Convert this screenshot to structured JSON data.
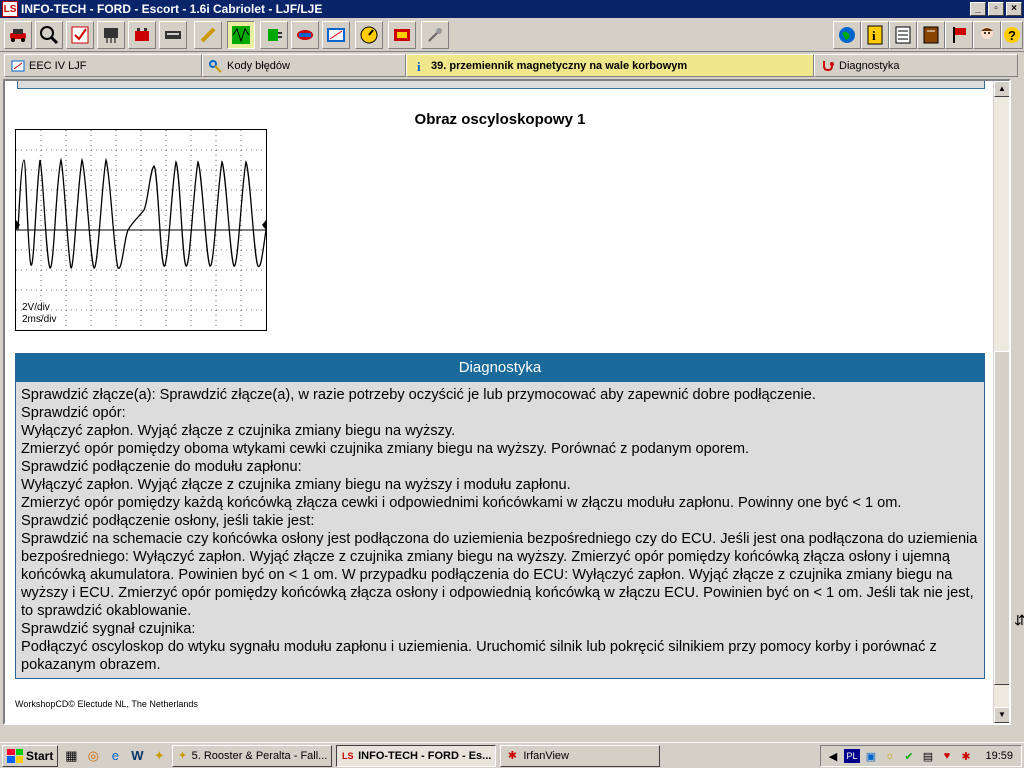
{
  "window": {
    "title": "INFO-TECH - FORD - Escort - 1.6i Cabriolet - LJF/LJE",
    "logo": "LS",
    "min_label": "_",
    "max_label": "▫",
    "close_label": "×"
  },
  "toolbar": {
    "left_icons": [
      "car-icon",
      "search-icon",
      "checklist-icon",
      "connector-icon",
      "battery-icon",
      "keyboard-icon",
      "pencil-icon",
      "oscilloscope-icon",
      "plug-icon",
      "component-icon",
      "module-icon",
      "dashboard-icon",
      "ecu-icon",
      "pin-icon"
    ],
    "right_icons": [
      "globe-icon",
      "info-icon",
      "list-icon",
      "book-icon",
      "flag-icon",
      "person-icon",
      "help-icon"
    ]
  },
  "tabs": [
    {
      "label": "EEC IV LJF",
      "icon": "module-icon"
    },
    {
      "label": "Kody błędów",
      "icon": "key-icon"
    },
    {
      "label": "39. przemiennik magnetyczny na wale korbowym",
      "icon": "info-icon"
    },
    {
      "label": "Diagnostyka",
      "icon": "stethoscope-icon"
    }
  ],
  "content": {
    "section_title": "Obraz oscyloskopowy 1",
    "scope_volt_label": "2V/div",
    "scope_time_label": "2ms/div",
    "diagnostics_title": "Diagnostyka",
    "diagnostics_lines": [
      "Sprawdzić złącze(a): Sprawdzić złącze(a), w razie potrzeby oczyścić je lub przymocować aby zapewnić dobre podłączenie.",
      "Sprawdzić opór:",
      "Wyłączyć zapłon. Wyjąć złącze z czujnika zmiany biegu na wyższy.",
      "Zmierzyć opór pomiędzy oboma wtykami cewki czujnika zmiany biegu na wyższy. Porównać z podanym oporem.",
      "Sprawdzić podłączenie do modułu zapłonu:",
      "Wyłączyć zapłon. Wyjąć złącze z czujnika zmiany biegu na wyższy i modułu zapłonu.",
      "Zmierzyć opór pomiędzy każdą końcówką złącza cewki i odpowiednimi końcówkami w złączu modułu zapłonu. Powinny one być < 1 om.",
      "Sprawdzić podłączenie osłony, jeśli takie jest:",
      "Sprawdzić na schemacie czy końcówka osłony jest podłączona do uziemienia bezpośredniego czy do ECU. Jeśli jest ona podłączona do uziemienia bezpośredniego: Wyłączyć zapłon. Wyjąć złącze z czujnika zmiany biegu na wyższy. Zmierzyć opór pomiędzy końcówką złącza osłony i ujemną końcówką akumulatora. Powinien być on < 1 om. W przypadku podłączenia do ECU: Wyłączyć zapłon. Wyjąć złącze z czujnika zmiany biegu na wyższy i ECU. Zmierzyć opór pomiędzy końcówką złącza osłony i odpowiednią końcówką w złączu ECU. Powinien być on < 1 om. Jeśli tak nie jest, to sprawdzić okablowanie.",
      "Sprawdzić sygnał czujnika:",
      "Podłączyć oscyloskop do wtyku sygnału modułu zapłonu i uziemienia. Uruchomić silnik lub pokręcić silnikiem przy pomocy korby i porównać z pokazanym obrazem."
    ],
    "footer": "WorkshopCD© Electude NL, The Netherlands"
  },
  "taskbar": {
    "start_label": "Start",
    "tasks": [
      {
        "label": "5. Rooster & Peralta - Fall...",
        "icon": "winamp-icon",
        "active": false
      },
      {
        "label": "INFO-TECH - FORD - Es...",
        "icon": "app-logo-icon",
        "active": true
      },
      {
        "label": "IrfanView",
        "icon": "irfanview-icon",
        "active": false
      }
    ],
    "tray_lang": "PL",
    "clock": "19:59"
  },
  "colors": {
    "titlebar": "#0a246a",
    "diag_header": "#1a6a9c",
    "active_tab": "#f0e68c",
    "active_tool": "#e8f0a0"
  }
}
